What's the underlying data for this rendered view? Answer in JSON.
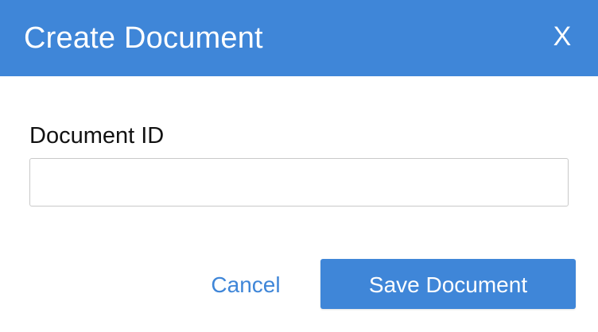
{
  "dialog": {
    "title": "Create Document",
    "close_label": "X"
  },
  "form": {
    "document_id_label": "Document ID",
    "document_id_value": "",
    "document_id_placeholder": ""
  },
  "actions": {
    "cancel_label": "Cancel",
    "save_label": "Save Document"
  },
  "colors": {
    "accent": "#3f86d8",
    "header_text": "#ffffff",
    "label_text": "#111111",
    "input_border": "#c9c9c9"
  },
  "icons": {
    "close": "close-icon"
  }
}
